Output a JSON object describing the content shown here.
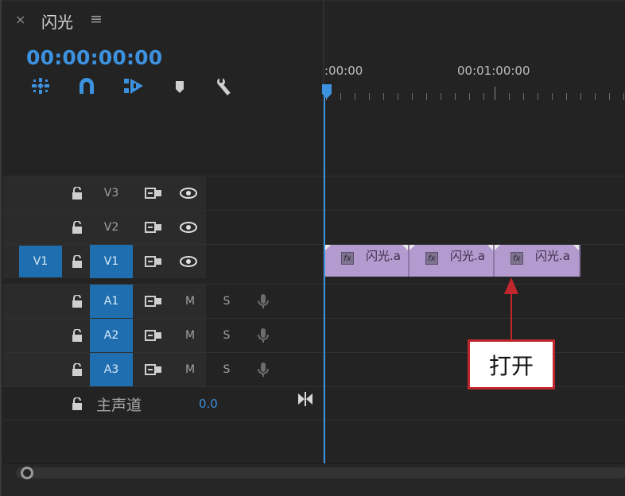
{
  "panel": {
    "close_glyph": "×",
    "title": "闪光",
    "menu_glyph": "≡",
    "timecode": "00:00:00:00"
  },
  "toolbar": {
    "icons": [
      "insert-nest-icon",
      "snap-magnet-icon",
      "linked-selection-icon",
      "add-marker-icon",
      "settings-wrench-icon"
    ]
  },
  "ruler": {
    "labels": [
      ":00:00",
      "00:01:00:00"
    ]
  },
  "tracks": {
    "video": [
      {
        "source": "",
        "target": "V3",
        "target_on": false
      },
      {
        "source": "",
        "target": "V2",
        "target_on": false
      },
      {
        "source": "V1",
        "target": "V1",
        "target_on": true
      }
    ],
    "audio": [
      {
        "target": "A1",
        "m": "M",
        "s": "S"
      },
      {
        "target": "A2",
        "m": "M",
        "s": "S"
      },
      {
        "target": "A3",
        "m": "M",
        "s": "S"
      }
    ],
    "master": {
      "label": "主声道",
      "value": "0.0"
    }
  },
  "clips": [
    {
      "fx": "fx",
      "name": "闪光.a"
    },
    {
      "fx": "fx",
      "name": "闪光.a"
    },
    {
      "fx": "fx",
      "name": "闪光.a"
    }
  ],
  "annotation": {
    "text": "打开",
    "color": "#c0282d"
  },
  "colors": {
    "accent": "#3d92e0",
    "clip": "#b49bcf",
    "target_on": "#1f6fb0"
  }
}
